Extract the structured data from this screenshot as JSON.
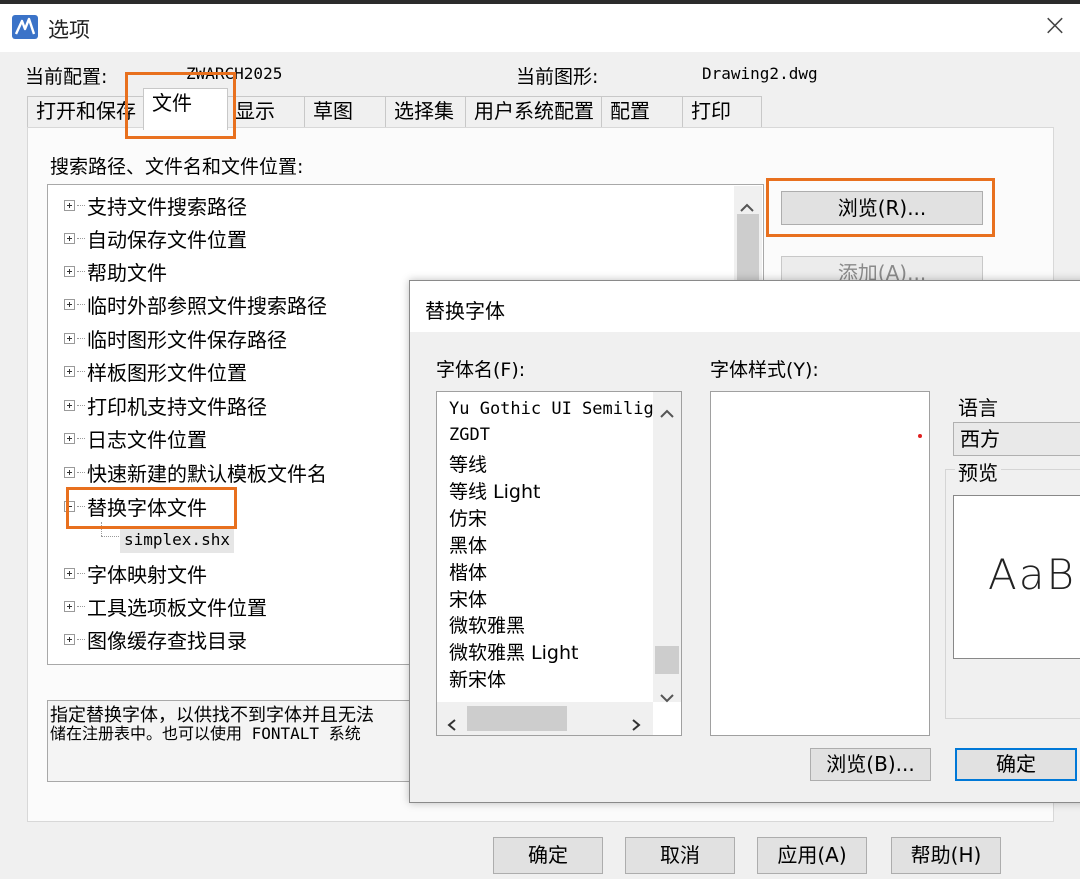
{
  "window": {
    "title": "选项",
    "close_glyph": "×"
  },
  "profile": {
    "label": "当前配置:",
    "value": "ZWARCH2025",
    "drawing_label": "当前图形:",
    "drawing_value": "Drawing2.dwg"
  },
  "tabs": [
    "打开和保存",
    "文件",
    "显示",
    "草图",
    "选择集",
    "用户系统配置",
    "配置",
    "打印"
  ],
  "tabs_active": "文件",
  "search_section": {
    "label": "搜索路径、文件名和文件位置:"
  },
  "tree": [
    "支持文件搜索路径",
    "自动保存文件位置",
    "帮助文件",
    "临时外部参照文件搜索路径",
    "临时图形文件保存路径",
    "样板图形文件位置",
    "打印机支持文件路径",
    "日志文件位置",
    "快速新建的默认模板文件名",
    "替换字体文件",
    "simplex.shx",
    "字体映射文件",
    "工具选项板文件位置",
    "图像缓存查找目录"
  ],
  "side_buttons": {
    "browse": "浏览(R)...",
    "add": "添加(A)..."
  },
  "description": {
    "line1": "指定替换字体，以供找不到字体并且无法",
    "line2": "储在注册表中。也可以使用 FONTALT 系统"
  },
  "footer": {
    "ok": "确定",
    "cancel": "取消",
    "apply": "应用(A)",
    "help": "帮助(H)"
  },
  "dialog": {
    "title": "替换字体",
    "font_name_label": "字体名(F):",
    "font_style_label": "字体样式(Y):",
    "fonts": [
      "Yu Gothic UI Semilig",
      "ZGDT",
      "等线",
      "等线 Light",
      "仿宋",
      "黑体",
      "楷体",
      "宋体",
      "微软雅黑",
      "微软雅黑 Light",
      "新宋体"
    ],
    "language_label": "语言",
    "language_value": "西方",
    "preview_label": "预览",
    "preview_text": "AaB",
    "browse_button": "浏览(B)...",
    "ok_button": "确定"
  },
  "colors": {
    "highlight": "#e8701e",
    "focus_border": "#0078d7",
    "app_icon": "#3b73c8"
  }
}
